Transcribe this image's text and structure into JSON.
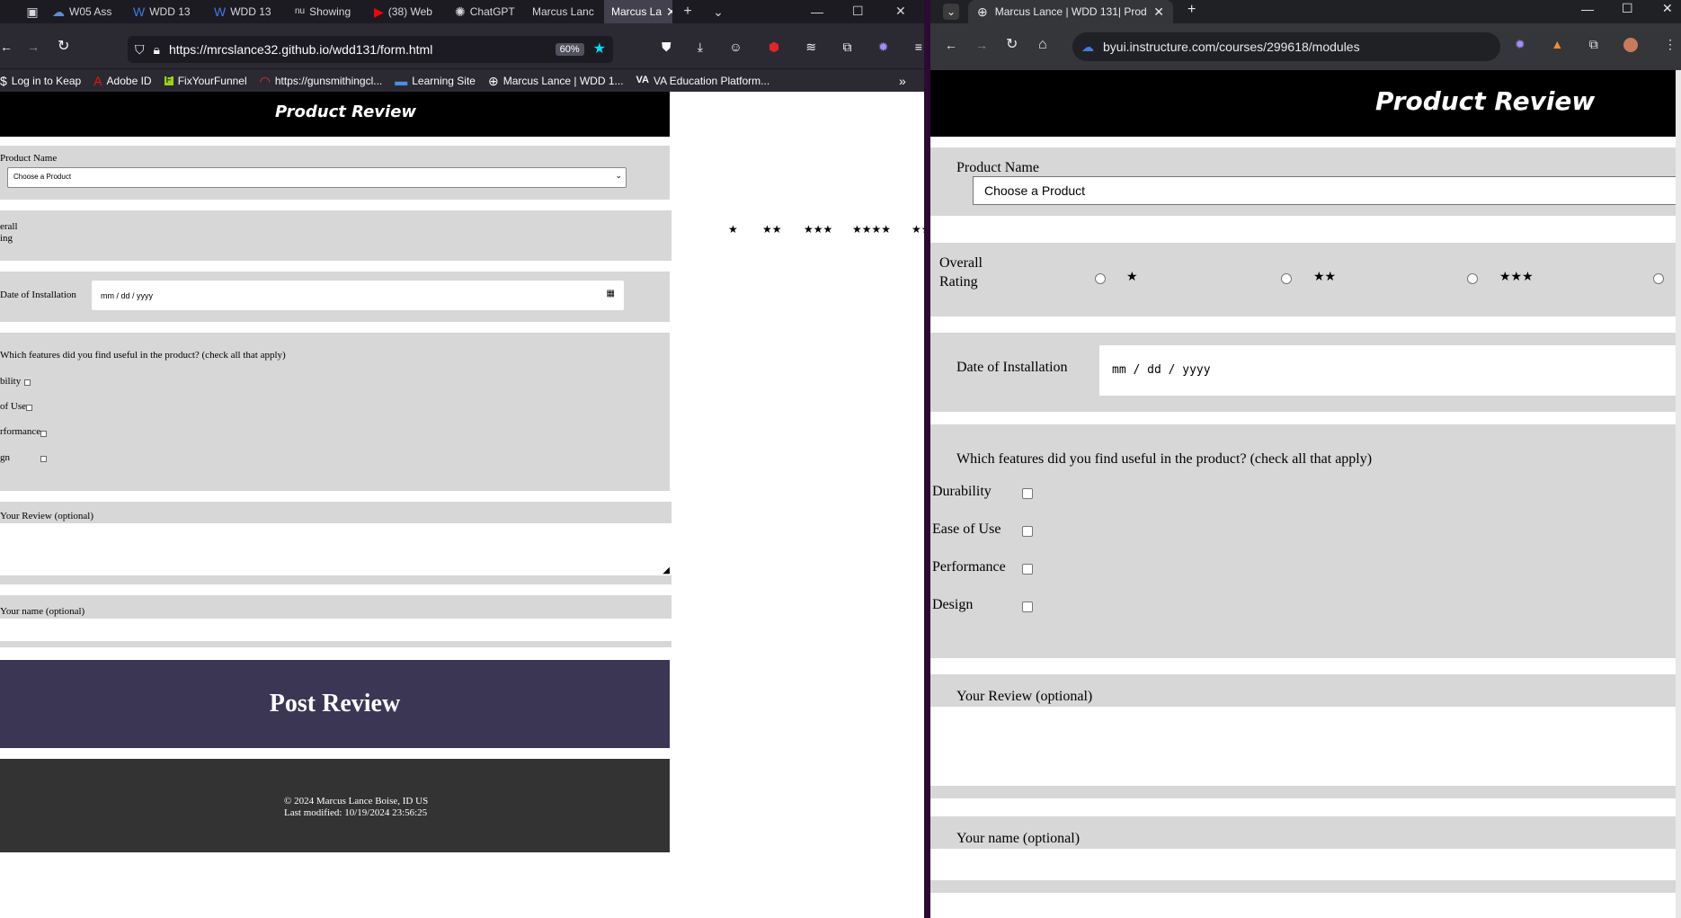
{
  "left_window": {
    "tabs": [
      {
        "label": "W05 Ass",
        "icon": "cloud-icon"
      },
      {
        "label": "WDD 13",
        "icon": "w-icon"
      },
      {
        "label": "WDD 13",
        "icon": "w-icon"
      },
      {
        "label": "Showing",
        "icon": "nu-icon"
      },
      {
        "label": "(38) Web",
        "icon": "youtube-icon"
      },
      {
        "label": "ChatGPT",
        "icon": "chatgpt-icon"
      },
      {
        "label": "Marcus Lanc",
        "icon": ""
      },
      {
        "label": "Marcus La",
        "icon": "",
        "active": true
      }
    ],
    "url": "https://mrcslance32.github.io/wdd131/form.html",
    "zoom": "60%",
    "bookmarks": [
      {
        "label": "Log in to Keap",
        "icon": "keap-icon"
      },
      {
        "label": "Adobe ID",
        "icon": "adobe-icon"
      },
      {
        "label": "FixYourFunnel",
        "icon": "fyf-icon"
      },
      {
        "label": "https://gunsmithingcl...",
        "icon": "gun-icon"
      },
      {
        "label": "Learning Site",
        "icon": "learning-icon"
      },
      {
        "label": "Marcus Lance | WDD 1...",
        "icon": "globe-icon"
      },
      {
        "label": "VA Education Platform...",
        "icon": "va-icon"
      }
    ],
    "page": {
      "title": "Product Review",
      "product_label": "Product Name",
      "product_select": "Choose a Product",
      "rating_label_1": "erall",
      "rating_label_2": "ing",
      "stars": [
        "★",
        "★★",
        "★★★",
        "★★★★",
        "★★"
      ],
      "date_label": "Date of Installation",
      "date_placeholder": "mm / dd / yyyy",
      "features_question": "Which features did you find useful in the product? (check all that apply)",
      "features": [
        "bility",
        "of Use",
        "rformance",
        "gn"
      ],
      "review_label": "Your Review (optional)",
      "name_label": "Your name (optional)",
      "submit": "Post Review",
      "footer_line1": "© 2024 Marcus Lance Boise, ID US",
      "footer_line2": "Last modified: 10/19/2024 23:56:25"
    }
  },
  "right_window": {
    "tab_title": "Marcus Lance | WDD 131| Prod",
    "url": "byui.instructure.com/courses/299618/modules",
    "page": {
      "title": "Product Review",
      "product_label": "Product Name",
      "product_select": "Choose a Product",
      "rating_label_1": "Overall",
      "rating_label_2": "Rating",
      "stars": [
        "★",
        "★★",
        "★★★"
      ],
      "date_label": "Date of Installation",
      "date_placeholder": "mm / dd / yyyy",
      "features_question": "Which features did you find useful in the product? (check all that apply)",
      "features": [
        "Durability",
        "Ease of Use",
        "Performance",
        "Design"
      ],
      "review_label": "Your Review (optional)",
      "name_label": "Your name (optional)"
    }
  },
  "colors": {
    "ff_chrome": "#2b2a33",
    "form_band": "#d6d7d6",
    "submit_bg": "#3b3653",
    "footer_bg": "#333333",
    "header_bg": "#000000"
  }
}
